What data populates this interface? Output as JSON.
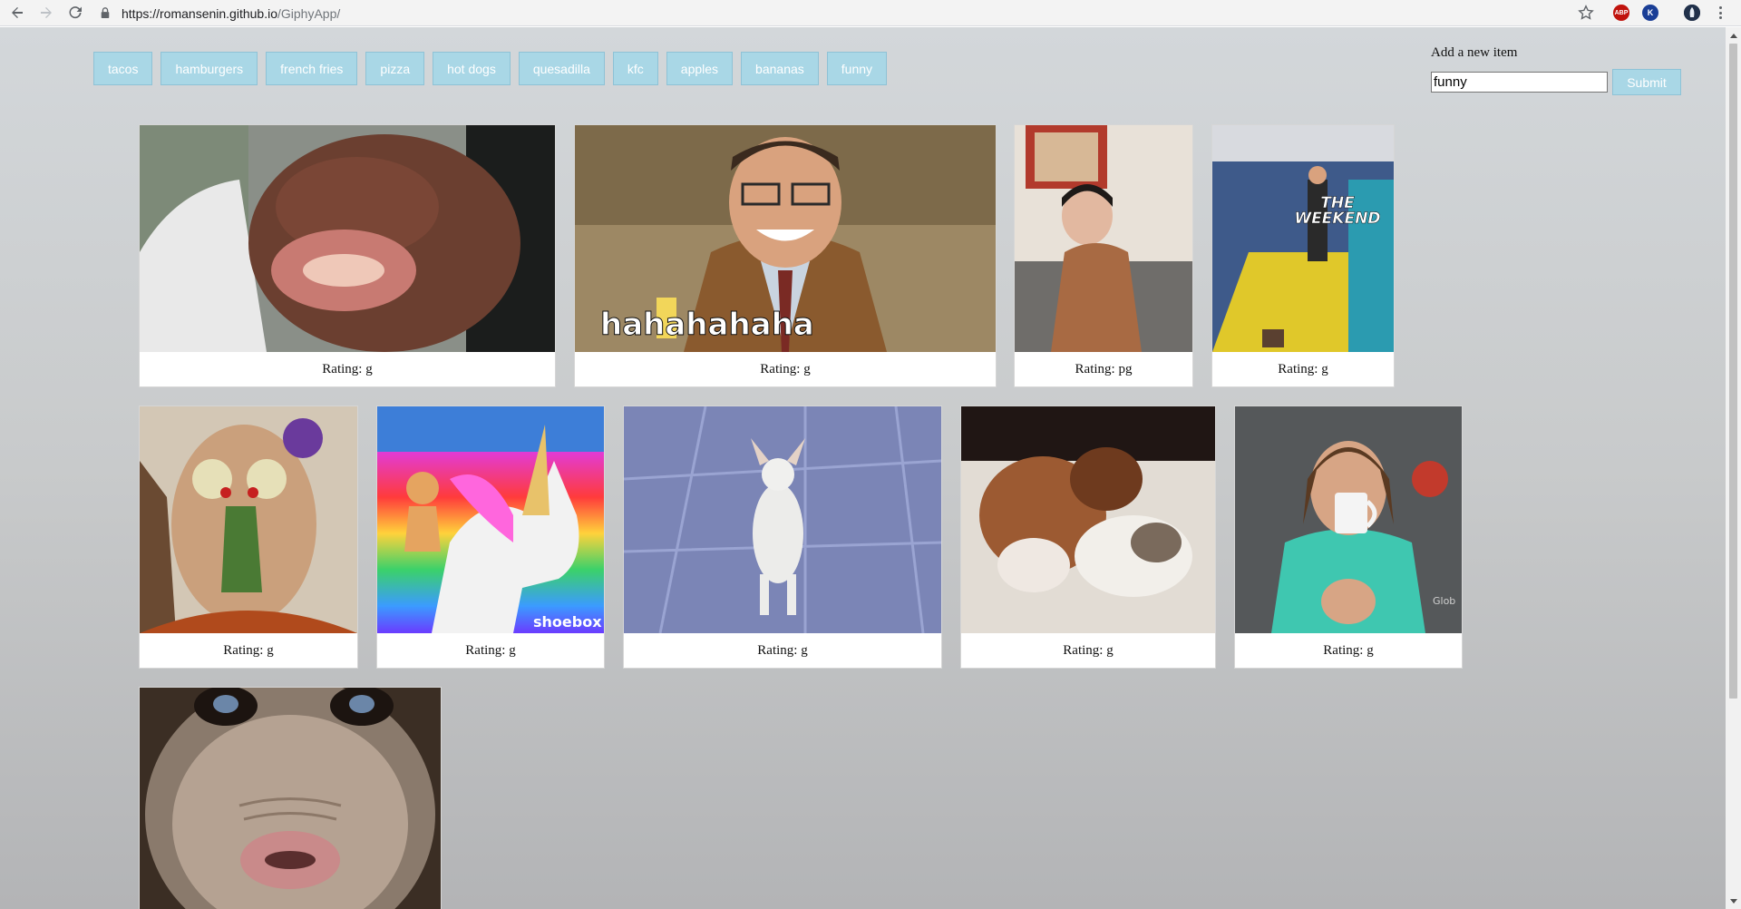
{
  "browser": {
    "url_host": "https://romansenin.github.io",
    "url_path": "/GiphyApp/",
    "ext_abp": "ABP",
    "ext_k": "K"
  },
  "topics": [
    "tacos",
    "hamburgers",
    "french fries",
    "pizza",
    "hot dogs",
    "quesadilla",
    "kfc",
    "apples",
    "bananas",
    "funny"
  ],
  "form": {
    "label": "Add a new item",
    "input_value": "funny",
    "submit_label": "Submit"
  },
  "gifs": [
    {
      "rating": "Rating: g",
      "subject": "dog-in-car"
    },
    {
      "rating": "Rating: g",
      "subject": "man-laughing",
      "caption": "hahahahaha"
    },
    {
      "rating": "Rating: pg",
      "subject": "woman-on-bed"
    },
    {
      "rating": "Rating: g",
      "subject": "weekend-gym",
      "caption": "THE WEEKEND"
    },
    {
      "rating": "Rating: g",
      "subject": "veggie-face"
    },
    {
      "rating": "Rating: g",
      "subject": "cat-on-unicorn",
      "caption": "shoebox"
    },
    {
      "rating": "Rating: g",
      "subject": "dancing-chihuahua"
    },
    {
      "rating": "Rating: g",
      "subject": "puppy-and-cat"
    },
    {
      "rating": "Rating: g",
      "subject": "woman-drinking",
      "caption": "Glob"
    },
    {
      "subject": "monkey-face"
    }
  ],
  "colors": {
    "button_bg": "#a9d7e6",
    "button_text": "#ffffff"
  }
}
